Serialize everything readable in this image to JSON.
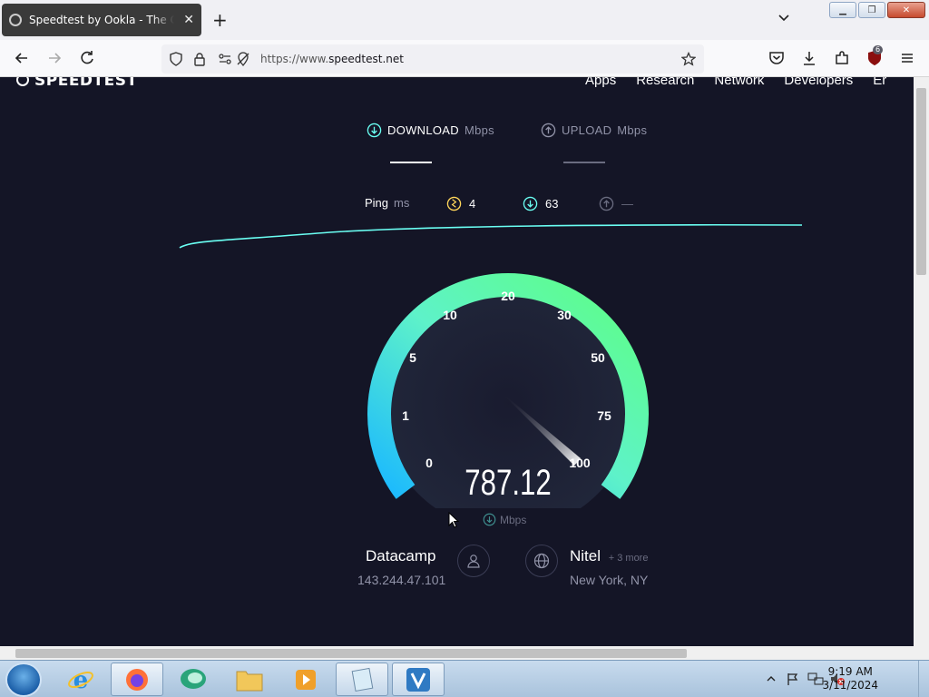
{
  "browser": {
    "tab_title": "Speedtest by Ookla - The Global Broadband Speed Test",
    "url_prefix": "https://www.",
    "url_host": "speedtest.net",
    "extension_badge": "6"
  },
  "site": {
    "logo": "SPEEDTEST",
    "nav": [
      "Apps",
      "Research",
      "Network",
      "Developers",
      "Er"
    ],
    "download_label": "DOWNLOAD",
    "upload_label": "UPLOAD",
    "unit": "Mbps",
    "ping_label": "Ping",
    "ping_unit": "ms",
    "ping_idle": "4",
    "ping_download": "63",
    "ping_upload": "—",
    "speed": "787.12",
    "gauge_ticks": [
      "0",
      "1",
      "5",
      "10",
      "20",
      "30",
      "50",
      "75",
      "100"
    ],
    "provider": "Datacamp",
    "ip": "143.244.47.101",
    "server": "Nitel",
    "server_more": "+ 3 more",
    "server_location": "New York, NY"
  },
  "taskbar": {
    "time": "9:19 AM",
    "date": "3/11/2024"
  },
  "colors": {
    "page_bg": "#141526",
    "accent_cyan": "#6afff3",
    "gauge_green": "#5eff82",
    "gauge_blue": "#1ab8ff"
  }
}
